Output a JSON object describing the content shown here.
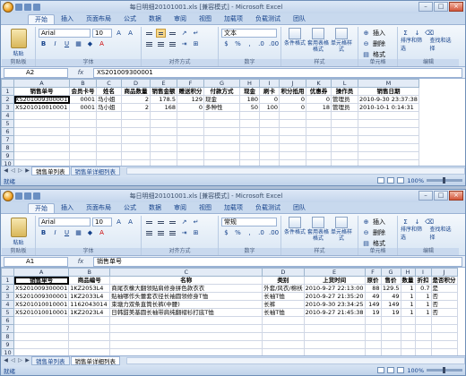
{
  "top": {
    "title": "每日明细20101001.xls [兼容模式] - Microsoft Excel",
    "window_buttons": [
      "–",
      "□",
      "×"
    ],
    "tabs": [
      "开始",
      "插入",
      "页面布局",
      "公式",
      "数据",
      "审阅",
      "视图",
      "加载项",
      "负载测试",
      "团队"
    ],
    "ribbon": {
      "paste": "粘贴",
      "font_name": "Arial",
      "font_size": "10",
      "number_format": "文本",
      "styles": [
        "条件格式",
        "套用表格格式",
        "单元格样式"
      ],
      "cells": [
        "插入",
        "删除",
        "格式"
      ],
      "editing": [
        "排序和筛选",
        "查找和选择"
      ],
      "groups": [
        "剪贴板",
        "字体",
        "对齐方式",
        "数字",
        "样式",
        "单元格",
        "编辑"
      ]
    },
    "name_box": "A2",
    "formula": "XS201009300001",
    "columns": [
      "A",
      "B",
      "C",
      "D",
      "E",
      "F",
      "G",
      "H",
      "I",
      "J",
      "K",
      "L",
      "M"
    ],
    "rows": [
      {
        "n": "1",
        "cells": [
          "销售单号",
          "会员卡号",
          "姓名",
          "商品数量",
          "销售金额",
          "赠送积分",
          "付款方式",
          "现金",
          "刷卡",
          "积分抵用",
          "优惠券",
          "操作员",
          "销售日期"
        ]
      },
      {
        "n": "2",
        "cells": [
          "XS201009300001",
          "0001",
          "马小姐",
          "2",
          "178.5",
          "129",
          "现金",
          "180",
          "0",
          "0",
          "0",
          "管理员",
          "2010-9-30 23:37:38"
        ]
      },
      {
        "n": "3",
        "cells": [
          "XS201010010001",
          "0001",
          "马小姐",
          "2",
          "168",
          "0",
          "多种性",
          "50",
          "100",
          "0",
          "18",
          "管理员",
          "2010-10-1 0:14:31"
        ]
      },
      {
        "n": "4",
        "cells": []
      },
      {
        "n": "5",
        "cells": []
      },
      {
        "n": "6",
        "cells": []
      },
      {
        "n": "7",
        "cells": []
      },
      {
        "n": "8",
        "cells": []
      },
      {
        "n": "9",
        "cells": []
      },
      {
        "n": "10",
        "cells": []
      }
    ],
    "sheet_tabs": [
      "销售单列表",
      "销售单详细列表"
    ],
    "status": "就绪",
    "zoom": "100%"
  },
  "bottom": {
    "title": "每日明细20101001.xls [兼容模式] - Microsoft Excel",
    "window_buttons": [
      "–",
      "□",
      "×"
    ],
    "tabs": [
      "开始",
      "插入",
      "页面布局",
      "公式",
      "数据",
      "审阅",
      "视图",
      "加载项",
      "负载测试",
      "团队"
    ],
    "ribbon": {
      "paste": "粘贴",
      "font_name": "Arial",
      "font_size": "10",
      "number_format": "常规",
      "styles": [
        "条件格式",
        "套用表格格式",
        "单元格样式"
      ],
      "cells": [
        "插入",
        "删除",
        "格式"
      ],
      "editing": [
        "排序和筛选",
        "查找和选择"
      ],
      "groups": [
        "剪贴板",
        "字体",
        "对齐方式",
        "数字",
        "样式",
        "单元格",
        "编辑"
      ]
    },
    "name_box": "A1",
    "formula": "销售单号",
    "columns": [
      "A",
      "B",
      "C",
      "D",
      "E",
      "F",
      "G",
      "H",
      "I",
      "J"
    ],
    "rows": [
      {
        "n": "1",
        "cells": [
          "销售单号",
          "商品编号",
          "名称",
          "类别",
          "上货时间",
          "原价",
          "售价",
          "数量",
          "折扣",
          "是否积分"
        ]
      },
      {
        "n": "2",
        "cells": [
          "XS201009300001",
          "1KZ2053L4",
          "商尾衣橡大翻领贴肩修身拼色款衣衣",
          "外套/风衣/棉袄",
          "2010-9-27 22:13:00",
          "88",
          "129.5",
          "1",
          "0.7",
          "是"
        ]
      },
      {
        "n": "3",
        "cells": [
          "XS201009300001",
          "1KZ2033L4",
          "贴袖哪作头蕾套衣径长袖圆领修身T恤",
          "长袖T恤",
          "2010-9-27 21:35:20",
          "49",
          "49",
          "1",
          "1",
          "否"
        ]
      },
      {
        "n": "4",
        "cells": [
          "XS201010010001",
          "1162043014",
          "束塘力双条直筒长裤(中腰)",
          "长裤",
          "2010-9-30 23:34:25",
          "149",
          "149",
          "1",
          "1",
          "否"
        ]
      },
      {
        "n": "5",
        "cells": [
          "XS201010010001",
          "1KZ2023L4",
          "日韩甜美基圆长袖带肩纯翻褶衫打底T恤",
          "长袖T恤",
          "2010-9-27 21:45:38",
          "19",
          "19",
          "1",
          "1",
          "否"
        ]
      },
      {
        "n": "6",
        "cells": []
      },
      {
        "n": "7",
        "cells": []
      },
      {
        "n": "8",
        "cells": []
      },
      {
        "n": "9",
        "cells": []
      },
      {
        "n": "10",
        "cells": []
      },
      {
        "n": "11",
        "cells": []
      }
    ],
    "sheet_tabs": [
      "销售单列表",
      "销售单详细列表"
    ],
    "status": "就绪",
    "zoom": "100%"
  }
}
